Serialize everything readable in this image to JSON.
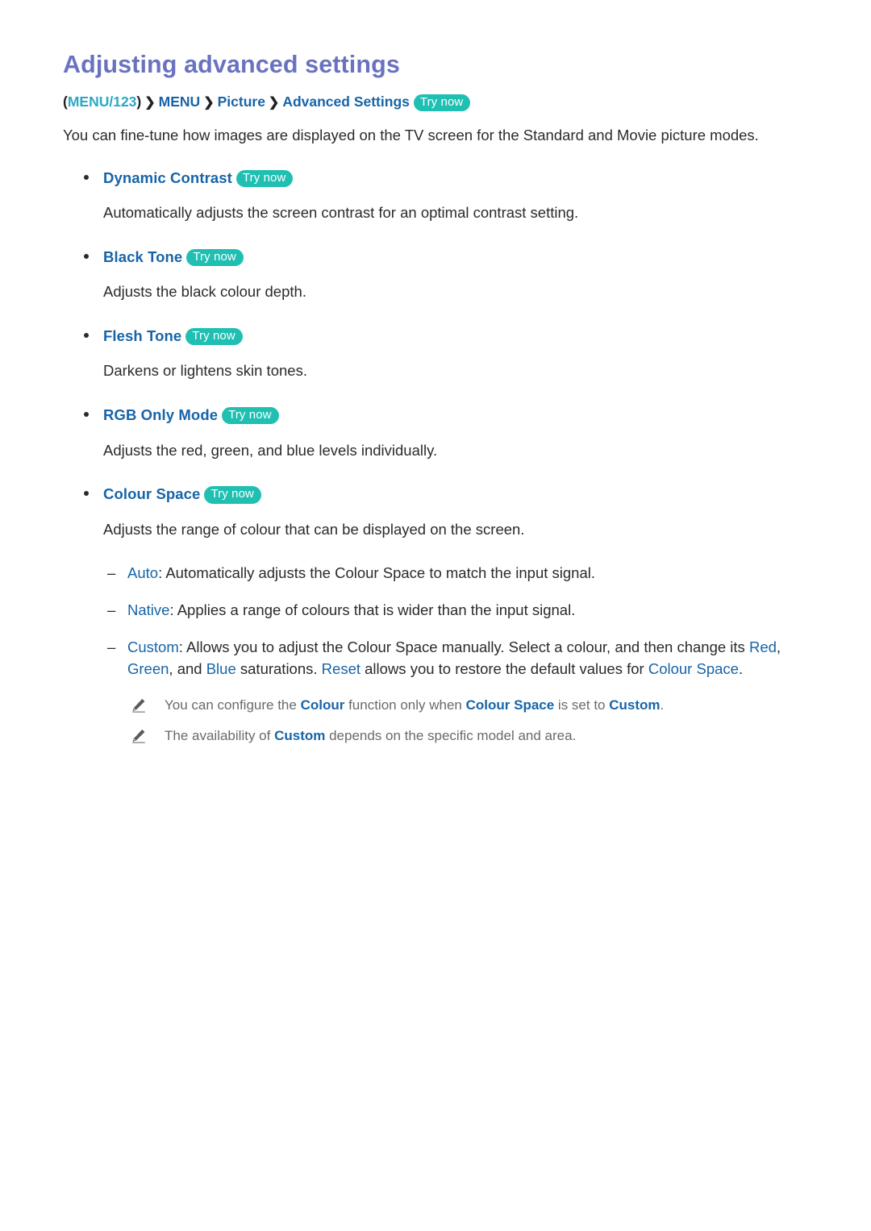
{
  "page": {
    "title": "Adjusting advanced settings",
    "intro": "You can fine-tune how images are displayed on the TV screen for the Standard and Movie picture modes."
  },
  "breadcrumb": {
    "open_paren": "(",
    "menu123": "MENU/123",
    "close_paren": ")",
    "separator": "❯",
    "items": [
      "MENU",
      "Picture",
      "Advanced Settings"
    ],
    "try_now": "Try now"
  },
  "common": {
    "try_now": "Try now",
    "bullet_glyph": "•",
    "dash_glyph": "–"
  },
  "settings": [
    {
      "label": "Dynamic Contrast",
      "try_now": "Try now",
      "description": "Automatically adjusts the screen contrast for an optimal contrast setting."
    },
    {
      "label": "Black Tone",
      "try_now": "Try now",
      "description": "Adjusts the black colour depth."
    },
    {
      "label": "Flesh Tone",
      "try_now": "Try now",
      "description": "Darkens or lightens skin tones."
    },
    {
      "label": "RGB Only Mode",
      "try_now": "Try now",
      "description": "Adjusts the red, green, and blue levels individually."
    },
    {
      "label": "Colour Space",
      "try_now": "Try now",
      "description": "Adjusts the range of colour that can be displayed on the screen."
    }
  ],
  "colour_space_options": {
    "auto": {
      "term": "Auto",
      "colon": ":",
      "text": " Automatically adjusts the Colour Space to match the input signal."
    },
    "native": {
      "term": "Native",
      "colon": ":",
      "text": " Applies a range of colours that is wider than the input signal."
    },
    "custom": {
      "term": "Custom",
      "colon": ":",
      "text_1": " Allows you to adjust the Colour Space manually. Select a colour, and then change its ",
      "hl_red": "Red",
      "text_2": ", ",
      "hl_green": "Green",
      "text_3": ", and ",
      "hl_blue": "Blue",
      "text_4": " saturations. ",
      "hl_reset": "Reset",
      "text_5": " allows you to restore the default values for ",
      "hl_colour_space": "Colour Space",
      "text_6": "."
    }
  },
  "notes": [
    {
      "icon": "pencil-icon",
      "text_1": "You can configure the ",
      "hl_1": "Colour",
      "text_2": " function only when ",
      "hl_2": "Colour Space",
      "text_3": " is set to ",
      "hl_3": "Custom",
      "text_4": "."
    },
    {
      "icon": "pencil-icon",
      "text_1": "The availability of ",
      "hl_1": "Custom",
      "text_2": " depends on the specific model and area.",
      "hl_2": "",
      "text_3": "",
      "hl_3": "",
      "text_4": ""
    }
  ],
  "colors": {
    "title": "#6a72c0",
    "link_blue": "#1764a8",
    "menu_teal": "#2aa8c4",
    "pill_teal": "#1fbfb2",
    "body_text": "#2b2b2b",
    "note_text": "#6a6a6a"
  }
}
